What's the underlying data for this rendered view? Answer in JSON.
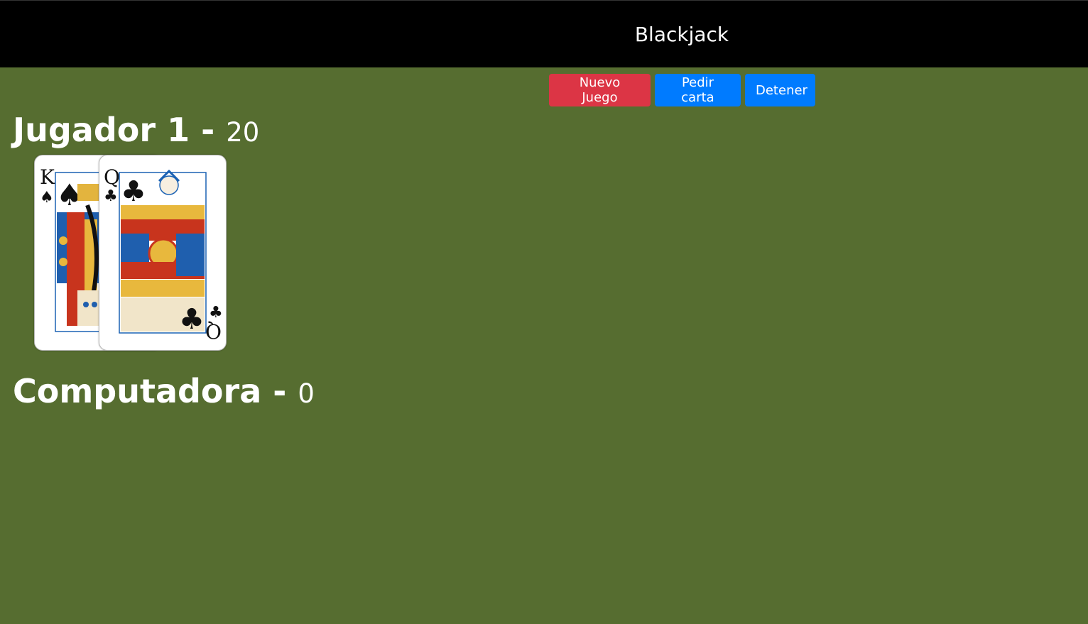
{
  "header": {
    "title": "Blackjack"
  },
  "controls": {
    "new_game_label": "Nuevo Juego",
    "hit_label": "Pedir carta",
    "stand_label": "Detener"
  },
  "player": {
    "name": "Jugador 1",
    "separator": " - ",
    "score": "20",
    "cards": [
      {
        "rank": "K",
        "suit": "♠",
        "icon": "king-of-spades"
      },
      {
        "rank": "Q",
        "suit": "♣",
        "icon": "queen-of-clubs"
      }
    ]
  },
  "computer": {
    "name": "Computadora",
    "separator": " - ",
    "score": "0"
  },
  "colors": {
    "table": "#566d30",
    "header": "#000000",
    "danger": "#dc3545",
    "primary": "#007bff"
  }
}
